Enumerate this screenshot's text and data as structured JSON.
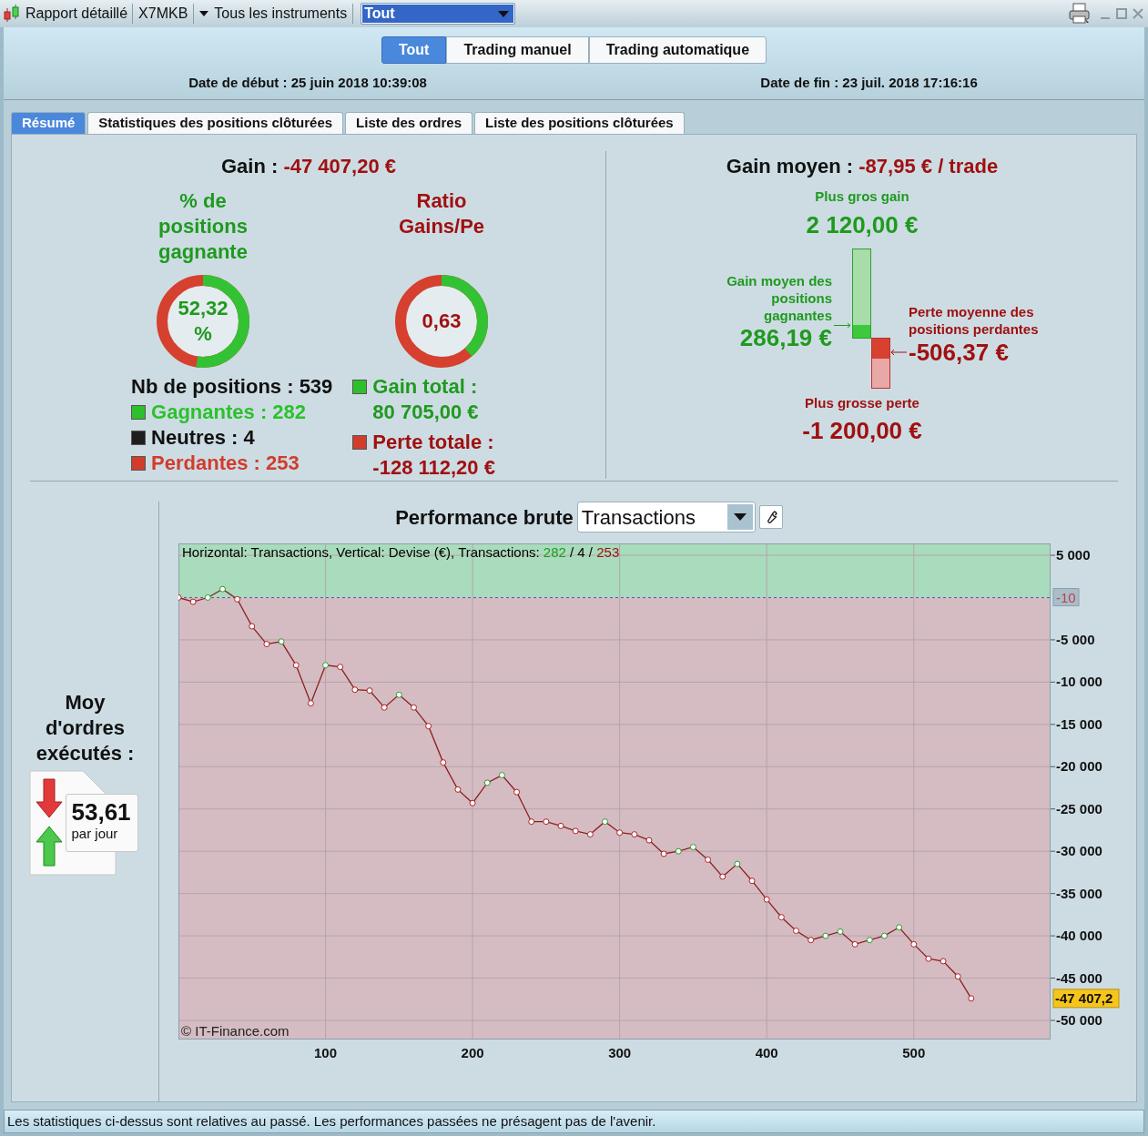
{
  "toolbar": {
    "title": "Rapport détaillé",
    "account": "X7MKB",
    "instruments": "Tous les instruments",
    "filter": "Tout"
  },
  "modes": [
    {
      "label": "Tout",
      "selected": true
    },
    {
      "label": "Trading manuel",
      "selected": false
    },
    {
      "label": "Trading automatique",
      "selected": false
    }
  ],
  "dates": {
    "start": "Date de début : 25 juin 2018 10:39:08",
    "end": "Date de fin : 23 juil. 2018 17:16:16"
  },
  "tabs": [
    {
      "label": "Résumé",
      "selected": true
    },
    {
      "label": "Statistiques des positions clôturées",
      "selected": false
    },
    {
      "label": "Liste des ordres",
      "selected": false
    },
    {
      "label": "Liste des positions clôturées",
      "selected": false
    }
  ],
  "summary": {
    "gain": {
      "label": "Gain :",
      "value": "-47 407,20 €"
    },
    "donuts": [
      {
        "title": "% de positions gagnante",
        "value": "52,32 %",
        "level": 0.5232,
        "color": "#1f9a1f"
      },
      {
        "title": "Ratio Gains/Pe",
        "value": "0,63",
        "level": 0.386,
        "color": "#a01010"
      }
    ],
    "positions": {
      "total": "Nb de positions : 539",
      "items": [
        {
          "text": "Gagnantes : 282",
          "color": "#2cc12c"
        },
        {
          "text": "Neutres : 4",
          "color": "#1e1e1e"
        },
        {
          "text": "Perdantes : 253",
          "color": "#d23c2c"
        }
      ]
    },
    "totals": [
      {
        "label": "Gain total :",
        "value": "80 705,00 €",
        "color": "#2cc12c"
      },
      {
        "label": "Perte totale :",
        "value": "-128 112,20 €",
        "color": "#d23c2c"
      }
    ]
  },
  "average": {
    "label": "Gain moyen :",
    "value": "-87,95 € / trade",
    "best_label": "Plus gros gain",
    "best": "2 120,00 €",
    "avg_win_label": "Gain moyen des positions gagnantes",
    "avg_win": "286,19 €",
    "avg_loss_label": "Perte moyenne des positions perdantes",
    "avg_loss": "-506,37 €",
    "worst_label": "Plus grosse perte",
    "worst": "-1 200,00 €"
  },
  "orders": {
    "label": "Moy d'ordres exécutés :",
    "value": "53,61",
    "unit": "par jour"
  },
  "performance": {
    "title": "Performance brute",
    "selector": "Transactions",
    "legend": [
      {
        "text": "Horizontal: Transactions, Vertical: Devise (€), Transactions: ",
        "color": "#000000"
      },
      {
        "text": "282",
        "color": "#1f9a1f"
      },
      {
        "text": " / 4 / ",
        "color": "#000000"
      },
      {
        "text": "253",
        "color": "#a01010"
      }
    ],
    "credit": "© IT-Finance.com",
    "chart_data": {
      "type": "line",
      "xlim": [
        0,
        593
      ],
      "ylim": [
        -52260,
        6400
      ],
      "xticks": [
        100,
        200,
        300,
        400,
        500
      ],
      "yticks": [
        {
          "value": 5000,
          "label": "5 000"
        },
        {
          "value": -5000,
          "label": "-5 000"
        },
        {
          "value": -10000,
          "label": "-10 000"
        },
        {
          "value": -15000,
          "label": "-15 000"
        },
        {
          "value": -20000,
          "label": "-20 000"
        },
        {
          "value": -25000,
          "label": "-25 000"
        },
        {
          "value": -30000,
          "label": "-30 000"
        },
        {
          "value": -35000,
          "label": "-35 000"
        },
        {
          "value": -40000,
          "label": "-40 000"
        },
        {
          "value": -45000,
          "label": "-45 000"
        },
        {
          "value": -50000,
          "label": "-50 000"
        }
      ],
      "x": [
        0,
        10,
        20,
        30,
        40,
        50,
        60,
        70,
        80,
        90,
        100,
        110,
        120,
        130,
        140,
        150,
        160,
        170,
        180,
        190,
        200,
        210,
        220,
        230,
        240,
        250,
        260,
        270,
        280,
        290,
        300,
        310,
        320,
        330,
        340,
        350,
        360,
        370,
        380,
        390,
        400,
        410,
        420,
        430,
        440,
        450,
        460,
        470,
        480,
        490,
        500,
        510,
        520,
        530,
        539
      ],
      "series": [
        {
          "color": "#8b2020",
          "marker": "o",
          "values": [
            0,
            -500,
            0,
            1000,
            -200,
            -3400,
            -5500,
            -5200,
            -8000,
            -12500,
            -8000,
            -8200,
            -10900,
            -11000,
            -13000,
            -11500,
            -13000,
            -15200,
            -19500,
            -22700,
            -24300,
            -21900,
            -21000,
            -23000,
            -26500,
            -26500,
            -27000,
            -27600,
            -28000,
            -26500,
            -27800,
            -28000,
            -28700,
            -30300,
            -30000,
            -29500,
            -31000,
            -33000,
            -31500,
            -33500,
            -35700,
            -37800,
            -39400,
            -40500,
            -40000,
            -39500,
            -41000,
            -40500,
            -40000,
            -39000,
            -41000,
            -42700,
            -43000,
            -44800,
            -47400
          ]
        }
      ],
      "grid": true,
      "bands": [
        {
          "axis": "y",
          "from": -10,
          "to": 6400,
          "color": "#a9dbbd"
        },
        {
          "axis": "y",
          "from": -52260,
          "to": -10,
          "color": "#d5bcc3"
        }
      ],
      "ref_lines": [
        {
          "axis": "y",
          "value": -10,
          "label": "-10",
          "color": "#5555aa"
        }
      ],
      "annotations": [
        "-47 407,2"
      ]
    }
  },
  "footer": "Les statistiques ci-dessus sont relatives au passé. Les performances passées ne présagent pas de l'avenir."
}
